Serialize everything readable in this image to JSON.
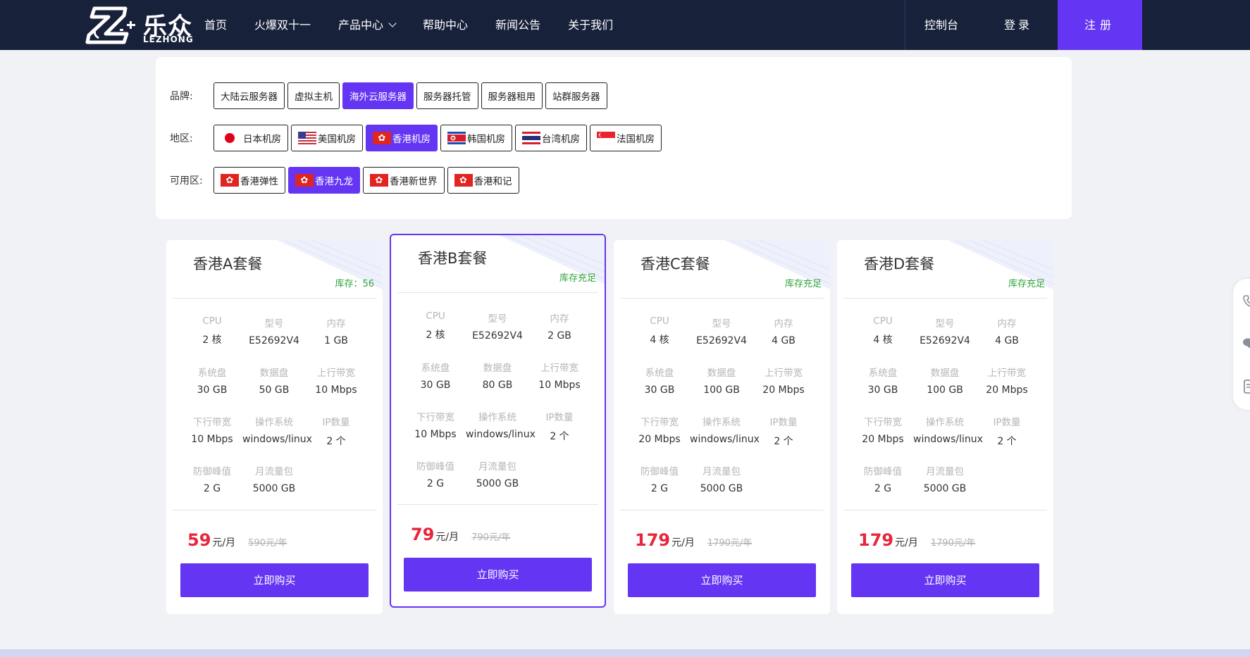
{
  "header": {
    "logo_cn": "乐众",
    "logo_en": "LEZHONG",
    "nav": [
      "首页",
      "火爆双十一",
      "产品中心",
      "帮助中心",
      "新闻公告",
      "关于我们"
    ],
    "console": "控制台",
    "login": "登录",
    "register": "注册"
  },
  "filter": {
    "brand_label": "品牌:",
    "brands": [
      "大陆云服务器",
      "虚拟主机",
      "海外云服务器",
      "服务器托管",
      "服务器租用",
      "站群服务器"
    ],
    "region_label": "地区:",
    "regions": [
      "日本机房",
      "美国机房",
      "香港机房",
      "韩国机房",
      "台湾机房",
      "法国机房"
    ],
    "zone_label": "可用区:",
    "zones": [
      "香港弹性",
      "香港九龙",
      "香港新世界",
      "香港和记"
    ]
  },
  "spec_labels": {
    "cpu": "CPU",
    "model": "型号",
    "memory": "内存",
    "sysdisk": "系统盘",
    "datadisk": "数据盘",
    "upbw": "上行带宽",
    "downbw": "下行带宽",
    "os": "操作系统",
    "ips": "IP数量",
    "ddos": "防御峰值",
    "traffic": "月流量包"
  },
  "cards": [
    {
      "title": "香港A套餐",
      "stock": "库存：56",
      "cpu": "2 核",
      "model": "E52692V4",
      "memory": "1 GB",
      "sysdisk": "30 GB",
      "datadisk": "50 GB",
      "upbw": "10 Mbps",
      "downbw": "10 Mbps",
      "os": "windows/linux",
      "ips": "2 个",
      "ddos": "2 G",
      "traffic": "5000 GB",
      "price": "59",
      "unit": "元/月",
      "orig": "590元/年",
      "buy": "立即购买"
    },
    {
      "title": "香港B套餐",
      "stock": "库存充足",
      "cpu": "2 核",
      "model": "E52692V4",
      "memory": "2 GB",
      "sysdisk": "30 GB",
      "datadisk": "80 GB",
      "upbw": "10 Mbps",
      "downbw": "10 Mbps",
      "os": "windows/linux",
      "ips": "2 个",
      "ddos": "2 G",
      "traffic": "5000 GB",
      "price": "79",
      "unit": "元/月",
      "orig": "790元/年",
      "buy": "立即购买"
    },
    {
      "title": "香港C套餐",
      "stock": "库存充足",
      "cpu": "4 核",
      "model": "E52692V4",
      "memory": "4 GB",
      "sysdisk": "30 GB",
      "datadisk": "100 GB",
      "upbw": "20 Mbps",
      "downbw": "20 Mbps",
      "os": "windows/linux",
      "ips": "2 个",
      "ddos": "2 G",
      "traffic": "5000 GB",
      "price": "179",
      "unit": "元/月",
      "orig": "1790元/年",
      "buy": "立即购买"
    },
    {
      "title": "香港D套餐",
      "stock": "库存充足",
      "cpu": "4 核",
      "model": "E52692V4",
      "memory": "4 GB",
      "sysdisk": "30 GB",
      "datadisk": "100 GB",
      "upbw": "20 Mbps",
      "downbw": "20 Mbps",
      "os": "windows/linux",
      "ips": "2 个",
      "ddos": "2 G",
      "traffic": "5000 GB",
      "price": "179",
      "unit": "元/月",
      "orig": "1790元/年",
      "buy": "立即购买"
    }
  ],
  "colors": {
    "accent": "#6535f4",
    "header_bg": "#17213a",
    "price": "#e8263a",
    "stock": "#2fa33a"
  },
  "icons": [
    "phone-icon",
    "chat-icon",
    "document-icon"
  ]
}
